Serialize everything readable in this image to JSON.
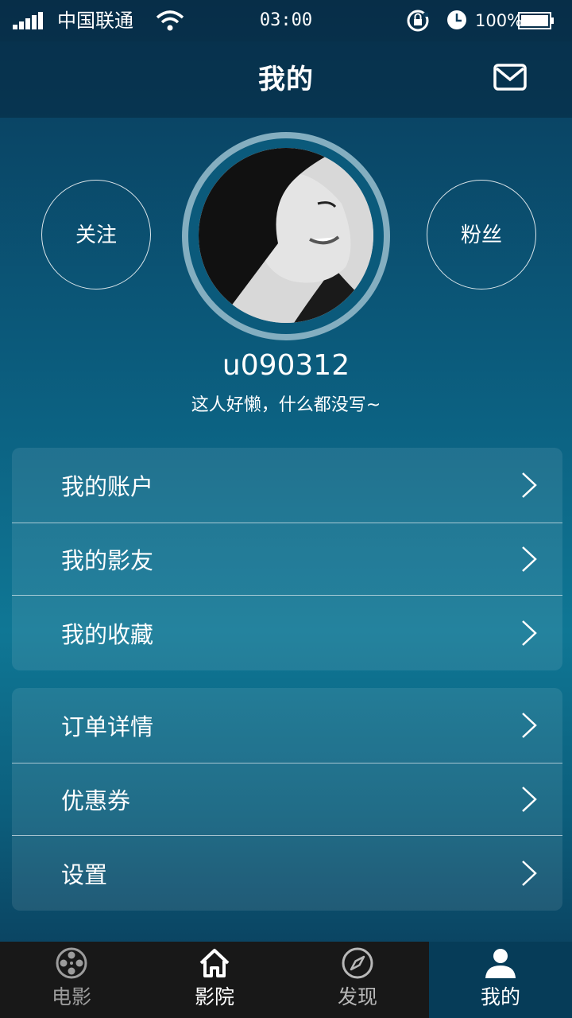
{
  "status_bar": {
    "carrier": "中国联通",
    "time": "03:00",
    "battery": "100%"
  },
  "header": {
    "title": "我的",
    "mail_icon": "mail-icon"
  },
  "profile": {
    "follow_label": "关注",
    "fans_label": "粉丝",
    "username": "u090312",
    "signature": "这人好懒，什么都没写~"
  },
  "menu_group_1": [
    {
      "label": "我的账户"
    },
    {
      "label": "我的影友"
    },
    {
      "label": "我的收藏"
    }
  ],
  "menu_group_2": [
    {
      "label": "订单详情"
    },
    {
      "label": "优惠券"
    },
    {
      "label": "设置"
    }
  ],
  "tabs": [
    {
      "label": "电影",
      "icon": "film-reel-icon"
    },
    {
      "label": "影院",
      "icon": "home-icon"
    },
    {
      "label": "发现",
      "icon": "compass-icon"
    },
    {
      "label": "我的",
      "icon": "user-icon"
    }
  ],
  "colors": {
    "active_tab": "#063c58",
    "tab_bar": "#181818",
    "avatar_ring": "#84aec0"
  }
}
